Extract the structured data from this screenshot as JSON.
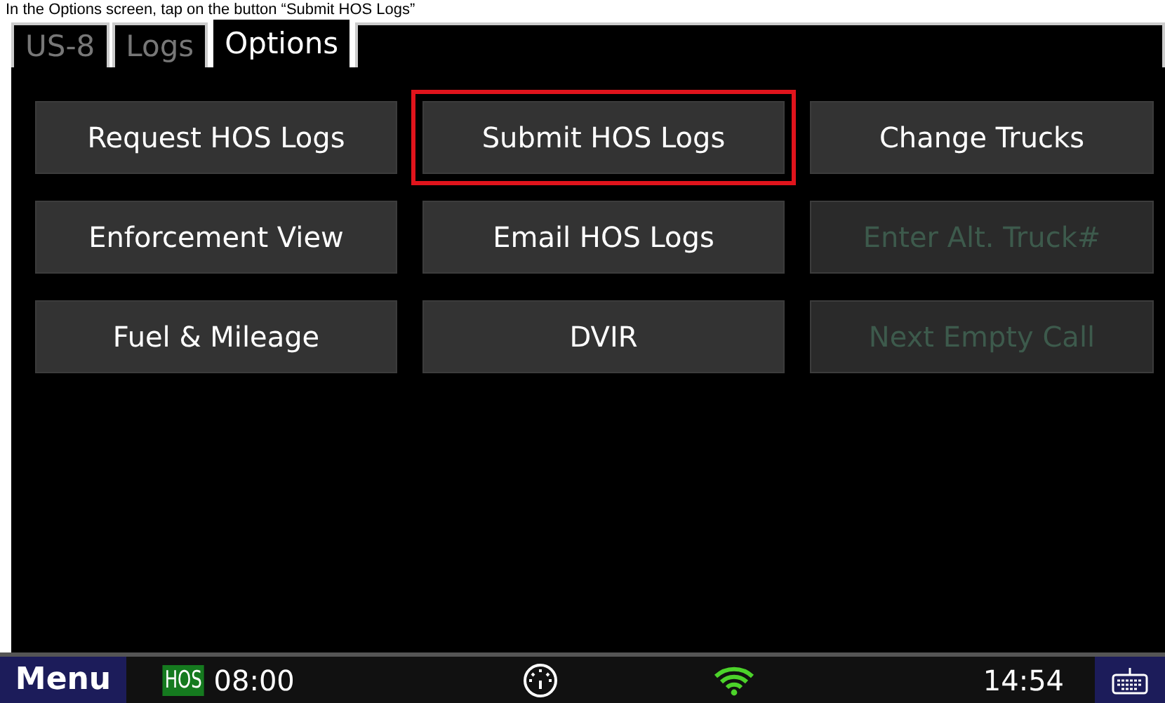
{
  "caption": "In the Options screen, tap on the button “Submit HOS Logs”",
  "tabs": [
    {
      "label": "US-8",
      "selected": false
    },
    {
      "label": "Logs",
      "selected": false
    },
    {
      "label": "Options",
      "selected": true
    }
  ],
  "buttons": [
    {
      "label": "Request HOS Logs",
      "disabled": false,
      "highlighted": false
    },
    {
      "label": "Submit HOS Logs",
      "disabled": false,
      "highlighted": true
    },
    {
      "label": "Change Trucks",
      "disabled": false,
      "highlighted": false
    },
    {
      "label": "Enforcement View",
      "disabled": false,
      "highlighted": false
    },
    {
      "label": "Email HOS Logs",
      "disabled": false,
      "highlighted": false
    },
    {
      "label": "Enter Alt. Truck#",
      "disabled": true,
      "highlighted": false
    },
    {
      "label": "Fuel & Mileage",
      "disabled": false,
      "highlighted": false
    },
    {
      "label": "DVIR",
      "disabled": false,
      "highlighted": false
    },
    {
      "label": "Next Empty Call",
      "disabled": true,
      "highlighted": false
    }
  ],
  "status_bar": {
    "menu": "Menu",
    "hos_badge": "HOS",
    "hos_time": "08:00",
    "clock": "14:54"
  }
}
